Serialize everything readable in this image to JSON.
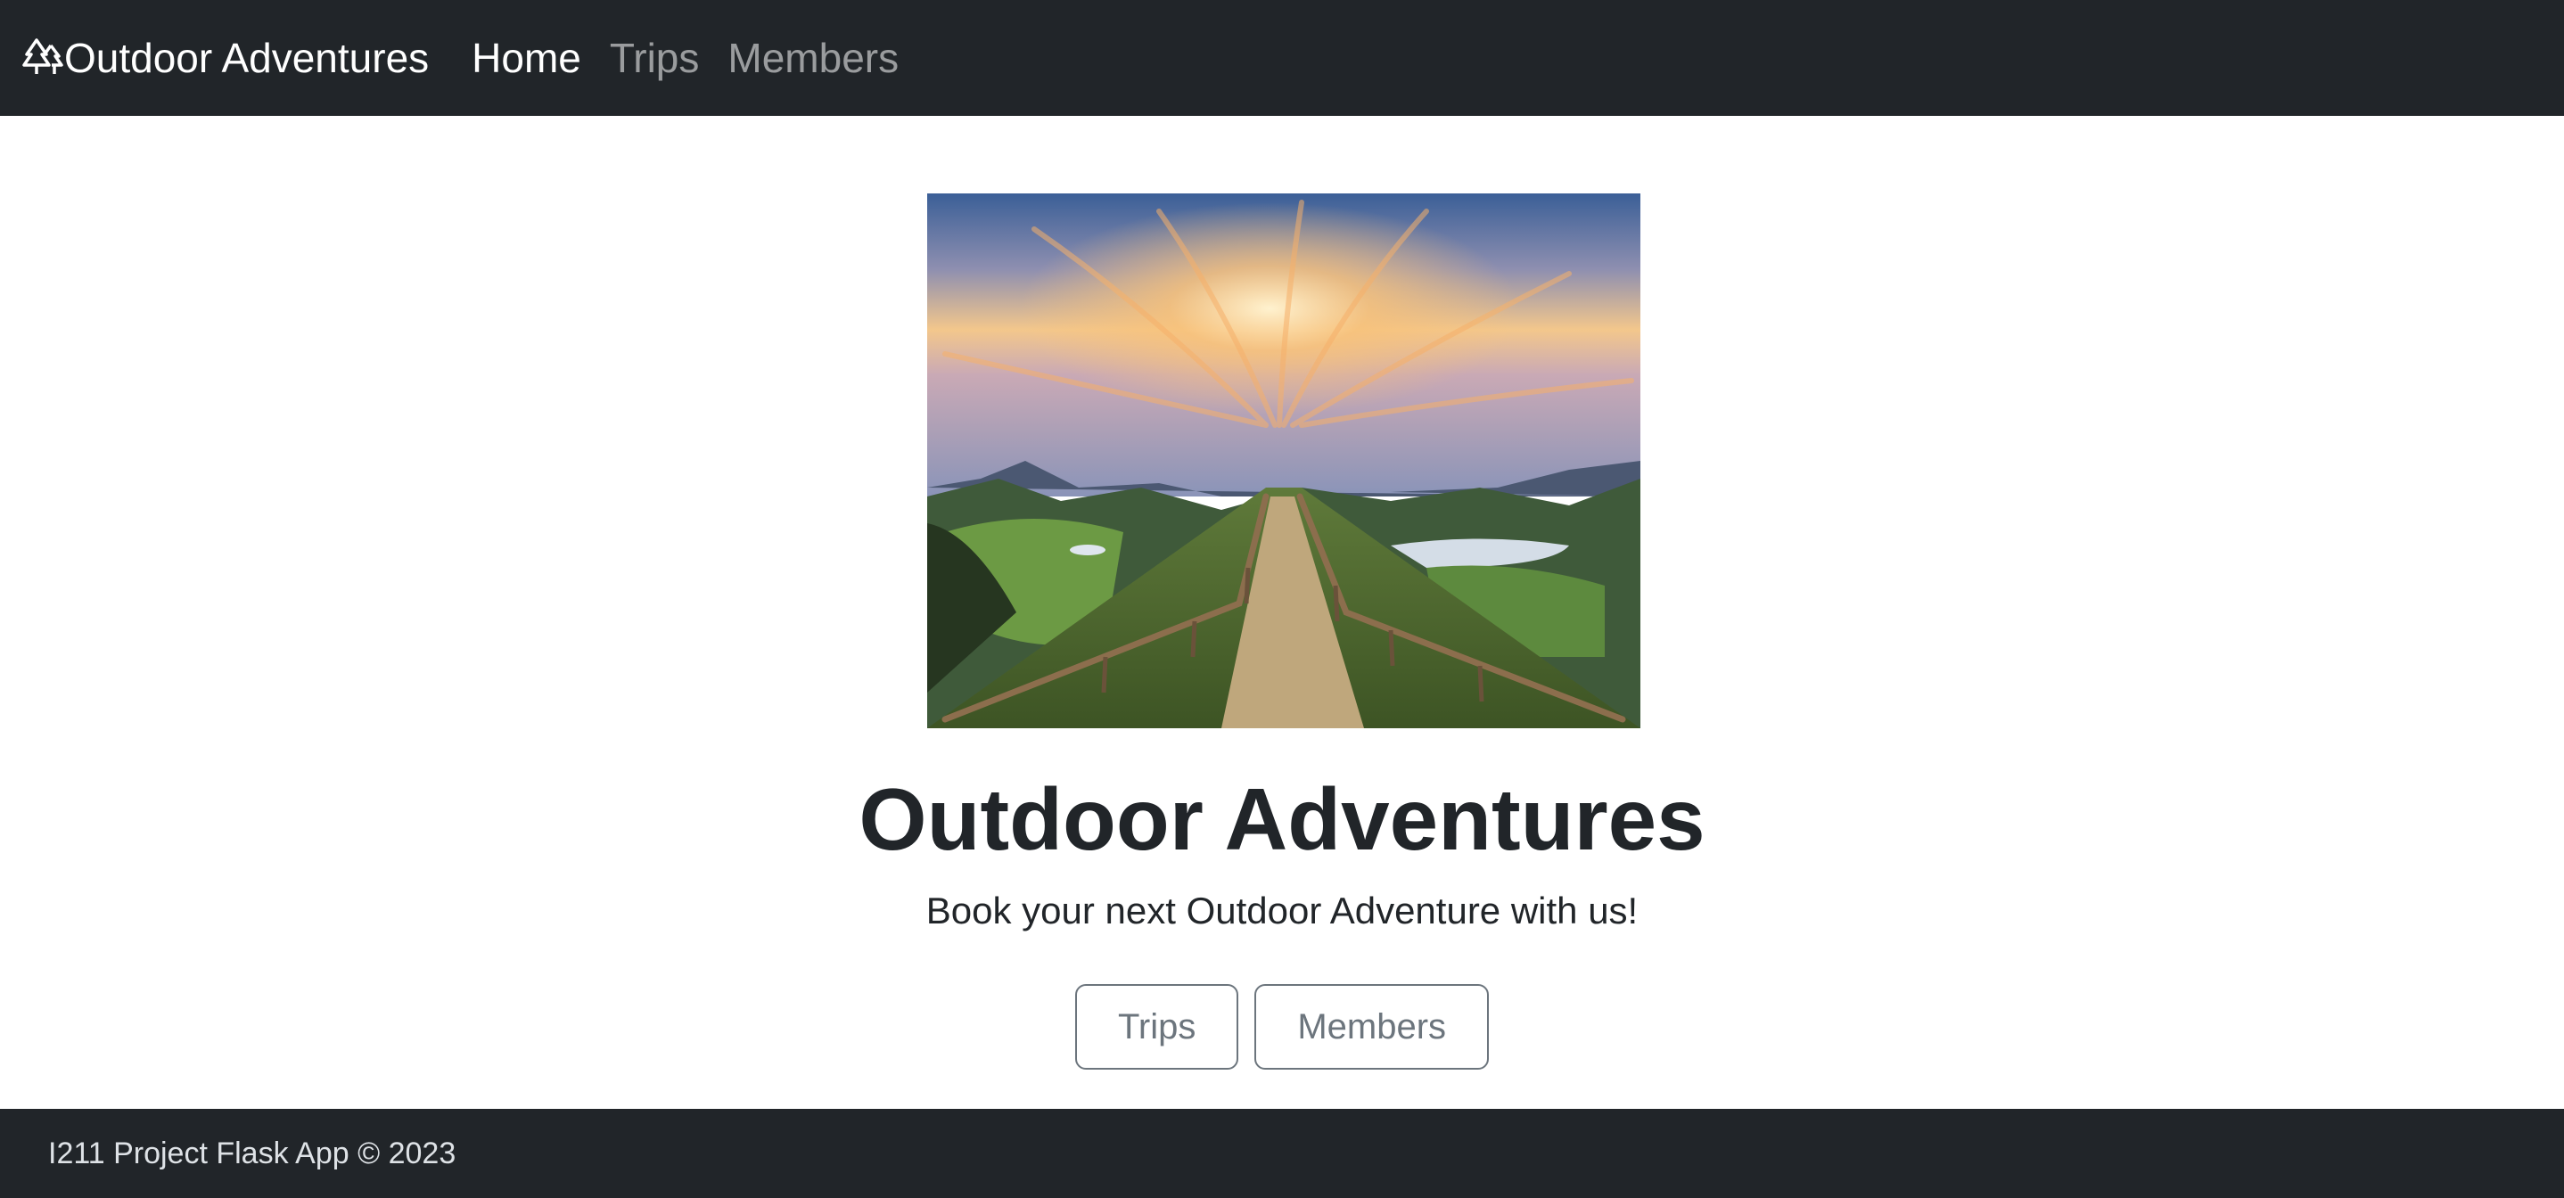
{
  "navbar": {
    "brand_icon": "trees-icon",
    "brand_text": "Outdoor Adventures",
    "links": [
      {
        "label": "Home",
        "active": true
      },
      {
        "label": "Trips",
        "active": false
      },
      {
        "label": "Members",
        "active": false
      }
    ],
    "background": "#212529"
  },
  "hero": {
    "image": "mountain-trail-sunset-photo",
    "title": "Outdoor Adventures",
    "lead": "Book your next Outdoor Adventure with us!",
    "buttons": [
      {
        "label": "Trips"
      },
      {
        "label": "Members"
      }
    ]
  },
  "footer": {
    "text": "I211 Project Flask App © 2023",
    "background": "#212529"
  }
}
